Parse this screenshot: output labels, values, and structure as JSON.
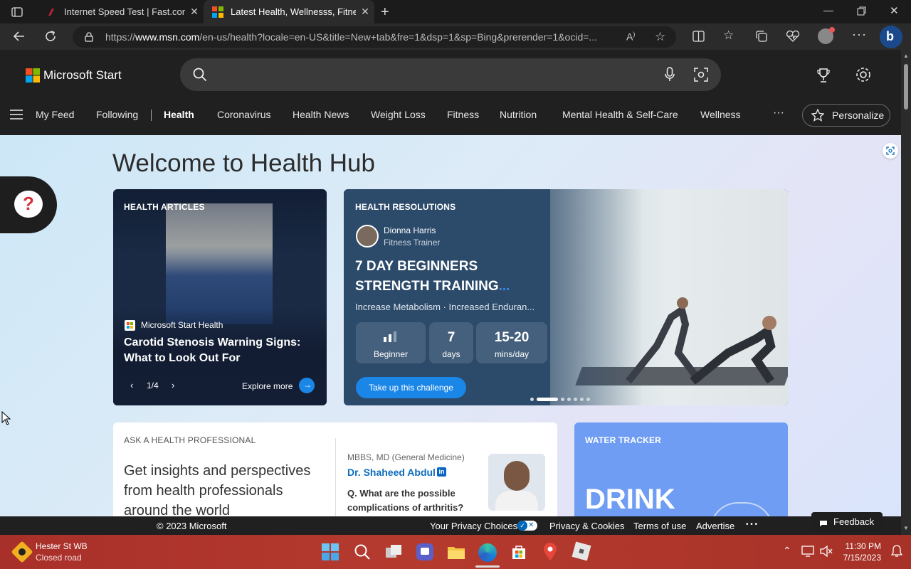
{
  "tabs": [
    {
      "title": "Internet Speed Test | Fast.com"
    },
    {
      "title": "Latest Health, Wellnesss, Fitness,"
    }
  ],
  "address": {
    "url_prefix": "https://",
    "url_domain": "www.msn.com",
    "url_rest": "/en-us/health?locale=en-US&title=New+tab&fre=1&dsp=1&sp=Bing&prerender=1&ocid=..."
  },
  "header": {
    "brand": "Microsoft Start"
  },
  "nav": {
    "items": [
      "My Feed",
      "Following",
      "Health",
      "Coronavirus",
      "Health News",
      "Weight Loss",
      "Fitness",
      "Nutrition",
      "Mental Health & Self-Care",
      "Wellness"
    ],
    "active": "Health",
    "more": "···",
    "personalize": "Personalize"
  },
  "main": {
    "title": "Welcome to Health Hub",
    "articles": {
      "label": "HEALTH ARTICLES",
      "source": "Microsoft Start Health",
      "headline": "Carotid Stenosis Warning Signs: What to Look Out For",
      "pager": "1/4",
      "explore": "Explore more"
    },
    "resolutions": {
      "label": "HEALTH RESOLUTIONS",
      "trainer_name": "Dionna Harris",
      "trainer_role": "Fitness Trainer",
      "title_line1": "7 DAY BEGINNERS",
      "title_line2": "STRENGTH TRAINING",
      "title_more": "...",
      "subtitle": "Increase Metabolism · Increased Enduran...",
      "stats": [
        {
          "value": "",
          "unit": "Beginner"
        },
        {
          "value": "7",
          "unit": "days"
        },
        {
          "value": "15-20",
          "unit": "mins/day"
        }
      ],
      "cta": "Take up this challenge"
    },
    "ask": {
      "label": "ASK A HEALTH PROFESSIONAL",
      "text": "Get insights and perspectives from health professionals around the world",
      "credentials": "MBBS, MD (General Medicine)",
      "doctor": "Dr. Shaheed Abdul",
      "question": "Q. What are the possible complications of arthritis?"
    },
    "water": {
      "label": "WATER TRACKER",
      "big": "DRINK"
    }
  },
  "footer": {
    "copyright": "© 2023 Microsoft",
    "privacy_choices": "Your Privacy Choices",
    "privacy": "Privacy & Cookies",
    "terms": "Terms of use",
    "advertise": "Advertise",
    "more": "• • •",
    "feedback": "Feedback"
  },
  "taskbar": {
    "traffic_title": "Hester St WB",
    "traffic_sub": "Closed road",
    "time": "11:30 PM",
    "date": "7/15/2023"
  },
  "colors": {
    "accent": "#0078d4",
    "taskbar": "#b33a2e"
  }
}
